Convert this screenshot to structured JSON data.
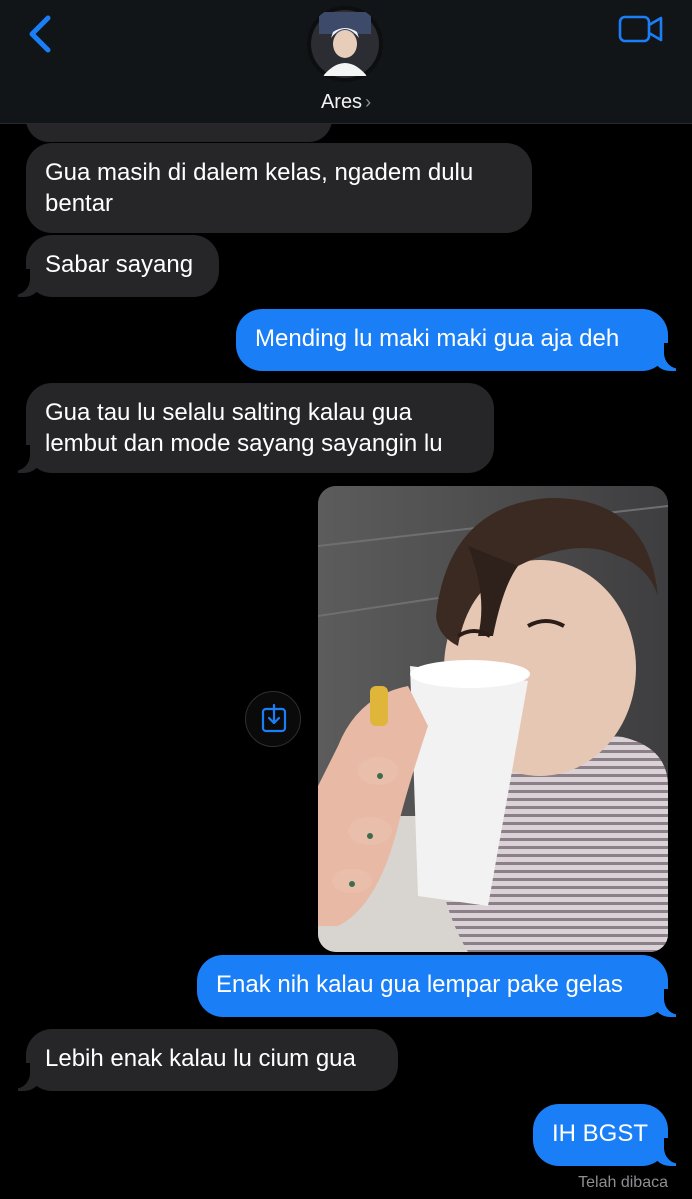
{
  "header": {
    "contact_name": "Ares",
    "name_chevron": "›",
    "back_icon": "chevron-left-icon",
    "video_icon": "video-camera-icon",
    "accent_color": "#1a7ff7"
  },
  "messages": [
    {
      "side": "in",
      "text_lines": [
        "Gua masih di dalem kelas, ngadem dulu",
        "bentar"
      ]
    },
    {
      "side": "in",
      "text_lines": [
        "Sabar sayang"
      ]
    },
    {
      "side": "out",
      "text_lines": [
        "Mending lu maki maki gua aja deh"
      ]
    },
    {
      "side": "in",
      "text_lines": [
        "Gua tau lu selalu salting kalau gua",
        "lembut dan mode sayang sayangin lu"
      ]
    },
    {
      "side": "out",
      "type": "photo",
      "save_icon": "save-to-photos-icon"
    },
    {
      "side": "out",
      "text_lines": [
        "Enak nih kalau gua lempar pake gelas"
      ]
    },
    {
      "side": "in",
      "text_lines": [
        "Lebih enak kalau lu cium gua"
      ]
    },
    {
      "side": "out",
      "text_lines": [
        "IH BGST"
      ]
    }
  ],
  "status": {
    "read_receipt": "Telah dibaca"
  },
  "colors": {
    "incoming_bubble": "#262628",
    "outgoing_bubble": "#1a7ff7",
    "background": "#000000"
  }
}
